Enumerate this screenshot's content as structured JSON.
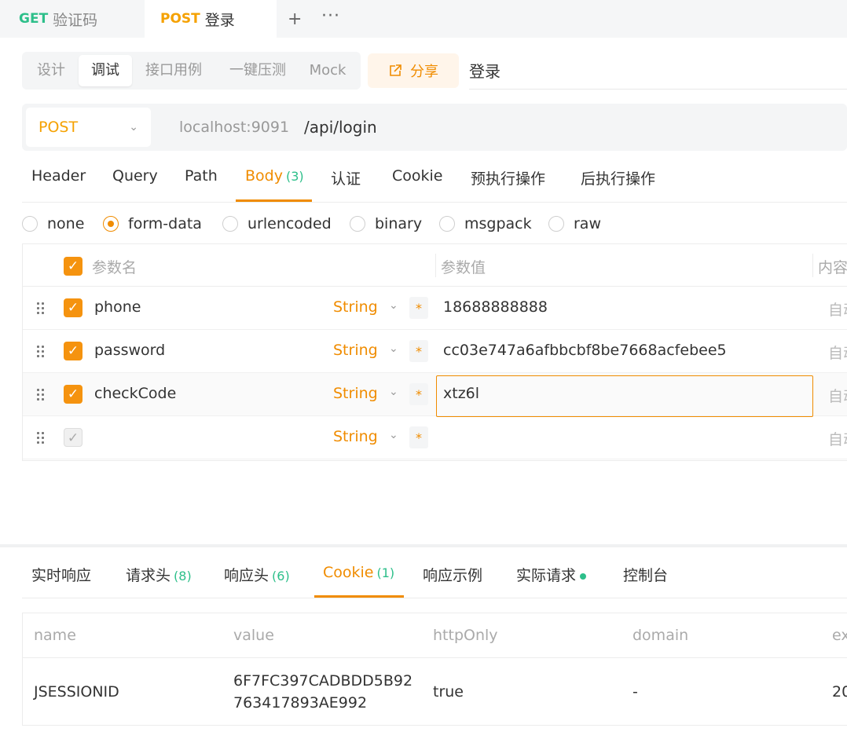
{
  "tabs": [
    {
      "method": "GET",
      "name": "验证码"
    },
    {
      "method": "POST",
      "name": "登录"
    }
  ],
  "tab_actions": {
    "add": "+",
    "more": "···"
  },
  "modes": [
    "设计",
    "调试",
    "接口用例",
    "一键压测",
    "Mock"
  ],
  "active_mode": "调试",
  "share_label": "分享",
  "api_name": "登录",
  "request": {
    "method": "POST",
    "host": "localhost:9091",
    "path": "/api/login"
  },
  "request_tabs": {
    "header": "Header",
    "query": "Query",
    "path": "Path",
    "body": "Body",
    "body_count": "(3)",
    "auth": "认证",
    "cookie": "Cookie",
    "pre": "预执行操作",
    "post": "后执行操作"
  },
  "body_types": [
    "none",
    "form-data",
    "urlencoded",
    "binary",
    "msgpack",
    "raw"
  ],
  "selected_body_type": "form-data",
  "params": {
    "headers": {
      "name": "参数名",
      "value": "参数值",
      "content": "内容"
    },
    "rows": [
      {
        "name": "phone",
        "type": "String",
        "required": "*",
        "value": "18688888888",
        "auto": "自动",
        "checked": true
      },
      {
        "name": "password",
        "type": "String",
        "required": "*",
        "value": "cc03e747a6afbbcbf8be7668acfebee5",
        "auto": "自动",
        "checked": true
      },
      {
        "name": "checkCode",
        "type": "String",
        "required": "*",
        "value": "xtz6l",
        "auto": "自动",
        "checked": true
      },
      {
        "name": "",
        "type": "String",
        "required": "*",
        "value": "",
        "auto": "自动",
        "checked": false
      }
    ]
  },
  "response_tabs": {
    "realtime": "实时响应",
    "req_headers": "请求头",
    "req_headers_count": "(8)",
    "resp_headers": "响应头",
    "resp_headers_count": "(6)",
    "cookie": "Cookie",
    "cookie_count": "(1)",
    "example": "响应示例",
    "actual": "实际请求",
    "console": "控制台"
  },
  "cookies": {
    "headers": {
      "name": "name",
      "value": "value",
      "httpOnly": "httpOnly",
      "domain": "domain",
      "expires": "ex"
    },
    "rows": [
      {
        "name": "JSESSIONID",
        "value": "6F7FC397CADBDD5B92763417893AE992",
        "httpOnly": "true",
        "domain": "-",
        "expires": "20"
      }
    ]
  },
  "colors": {
    "accent": "#f08c00",
    "get": "#2dbf8a",
    "count": "#2dbf8a"
  }
}
